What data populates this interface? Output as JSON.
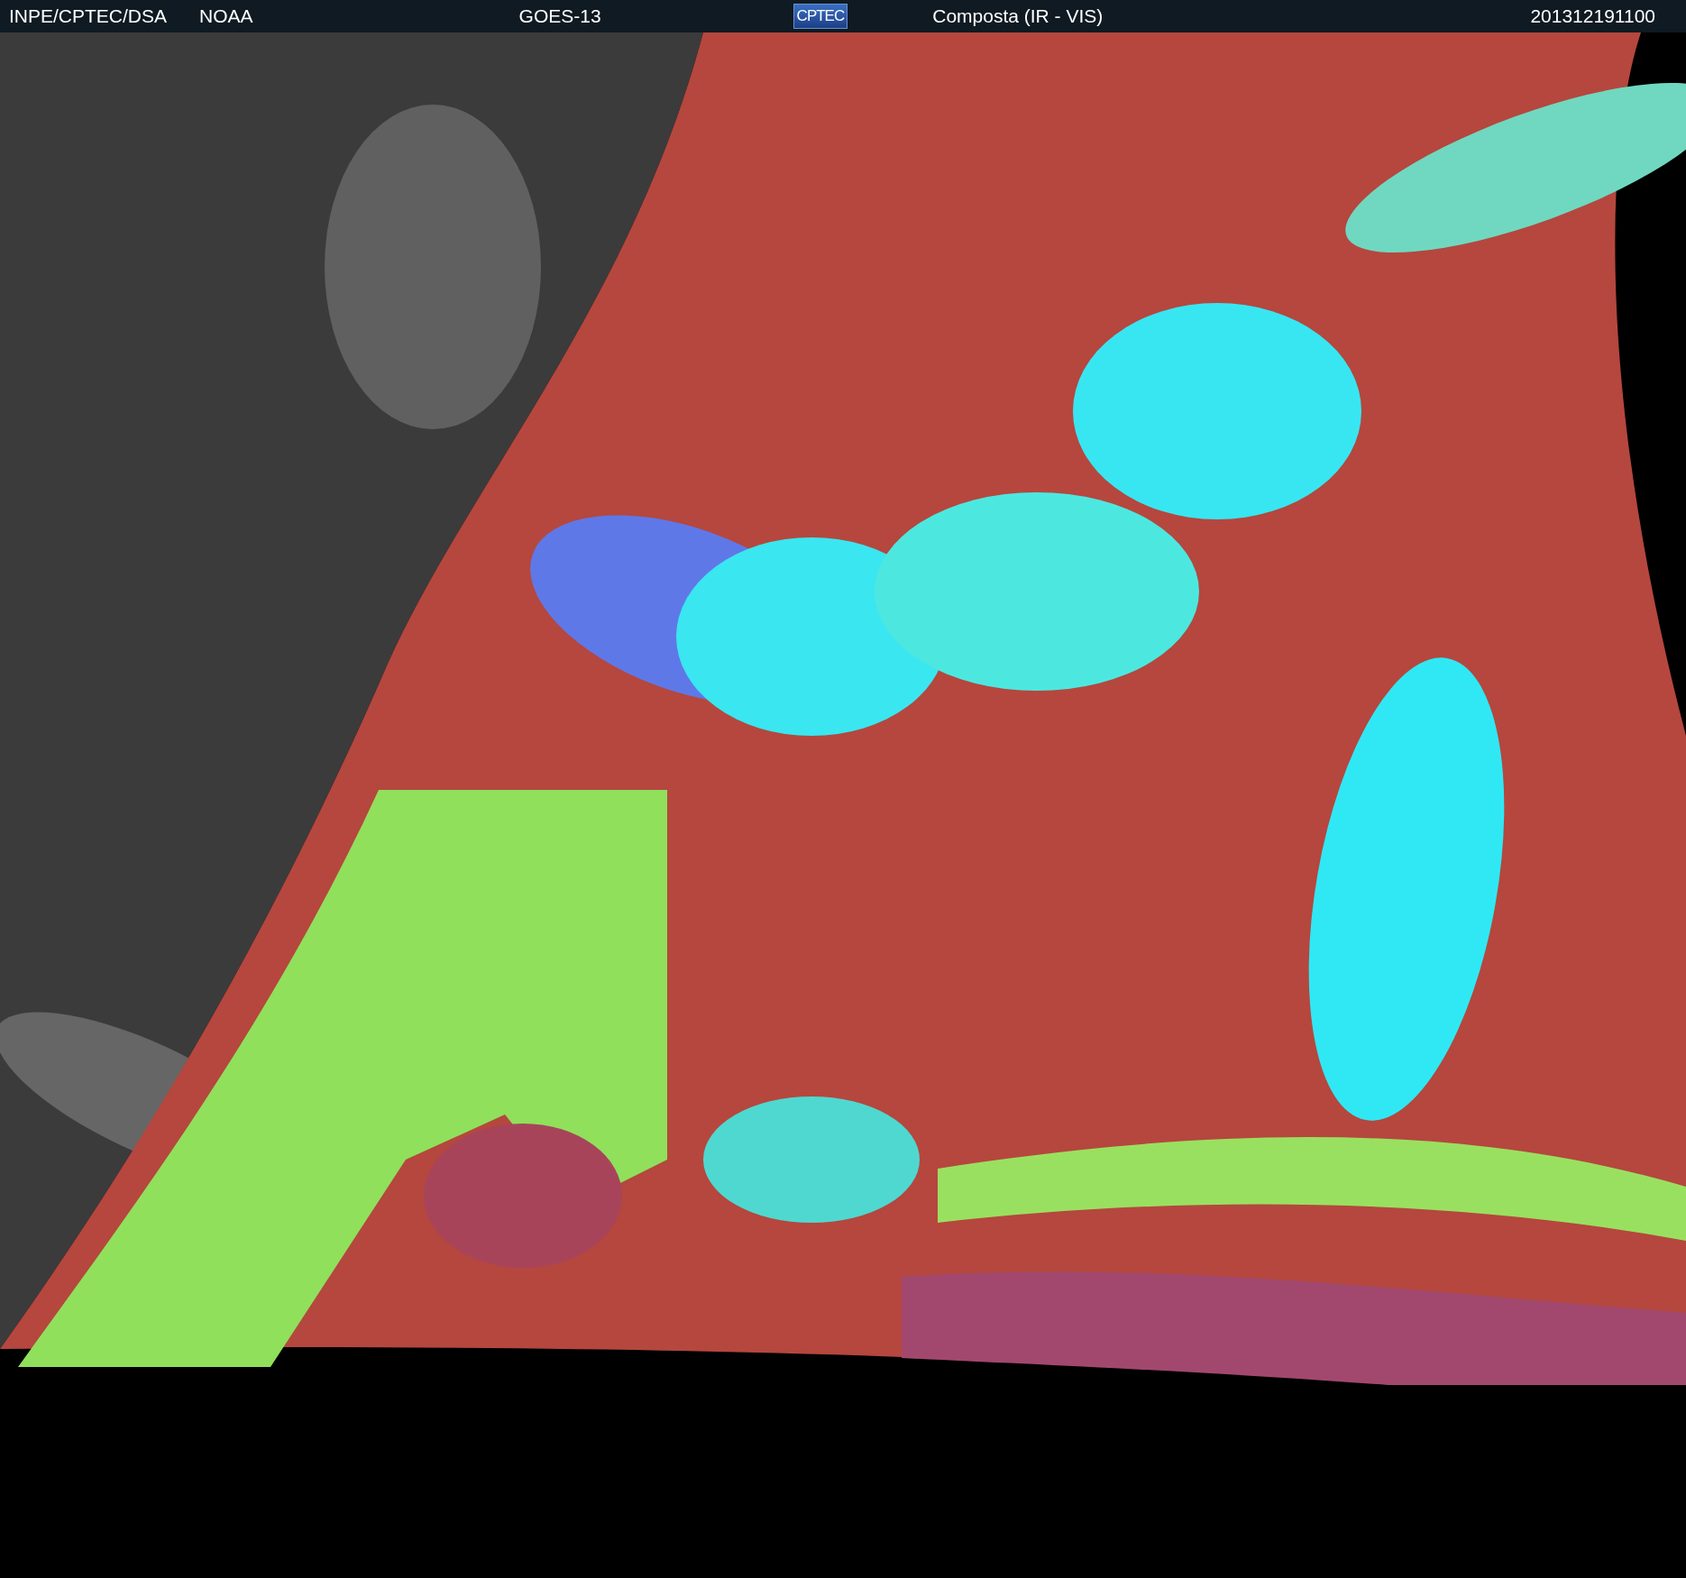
{
  "header": {
    "source": "INPE/CPTEC/DSA",
    "agency": "NOAA",
    "satellite": "GOES-13",
    "logo": "CPTEC",
    "product": "Composta (IR - VIS)",
    "timestamp": "201312191100"
  }
}
